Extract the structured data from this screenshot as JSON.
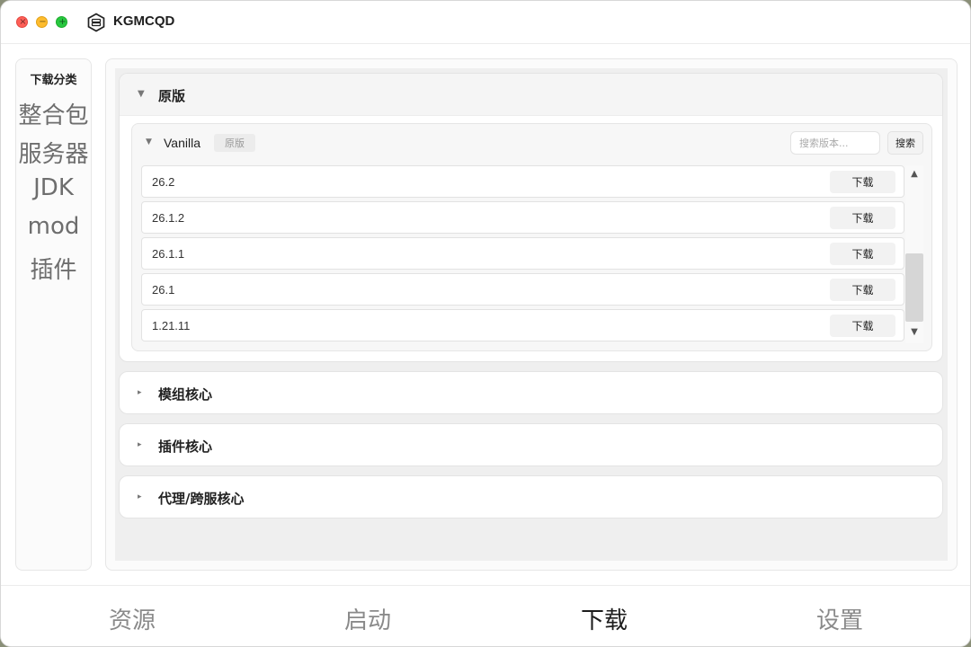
{
  "app": {
    "title": "KGMCQD"
  },
  "titlebar": {
    "close_glyph": "×",
    "min_glyph": "−",
    "max_glyph": "+"
  },
  "sidebar": {
    "title": "下载分类",
    "items": [
      {
        "label": "整合包"
      },
      {
        "label": "服务器"
      },
      {
        "label": "JDK"
      },
      {
        "label": "mod"
      },
      {
        "label": "插件"
      }
    ]
  },
  "sections": {
    "original": {
      "label": "原版",
      "expanded": true
    },
    "mod_core": {
      "label": "模组核心"
    },
    "plugin_core": {
      "label": "插件核心"
    },
    "proxy_core": {
      "label": "代理/跨服核心"
    }
  },
  "vanilla": {
    "name": "Vanilla",
    "tag": "原版",
    "search_placeholder": "搜索版本...",
    "search_button": "搜索",
    "download_label": "下载",
    "versions": [
      "26.2",
      "26.1.2",
      "26.1.1",
      "26.1",
      "1.21.11"
    ]
  },
  "icons": {
    "expand": "expand-arrow-icon",
    "collapse": "collapsed-arrow-icon",
    "scroll_up": "scroll-up-icon",
    "scroll_down": "scroll-down-icon",
    "logo": "app-logo-icon"
  },
  "bottom_nav": {
    "items": [
      {
        "label": "资源"
      },
      {
        "label": "启动"
      },
      {
        "label": "下载",
        "active": true
      },
      {
        "label": "设置"
      }
    ]
  }
}
